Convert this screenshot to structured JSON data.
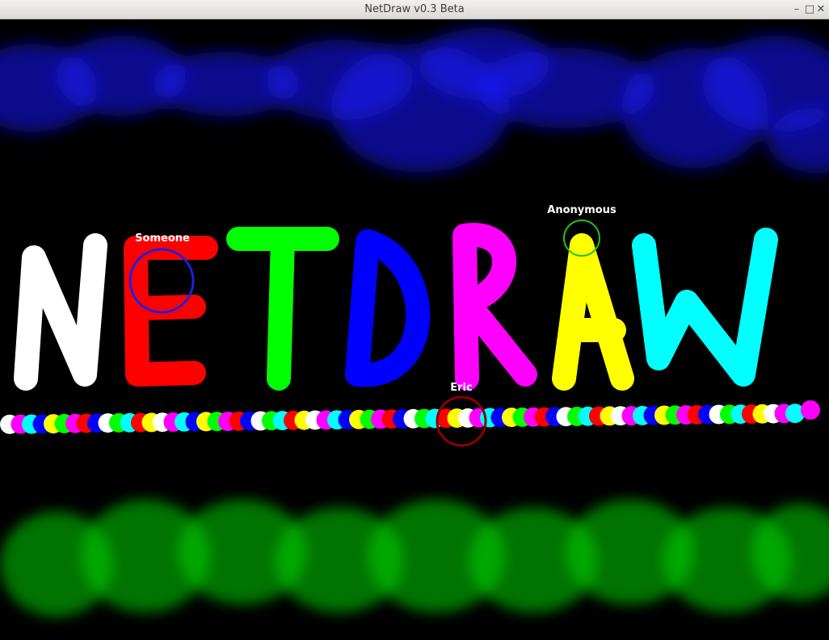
{
  "window": {
    "title": "NetDraw v0.3 Beta",
    "controls": {
      "minimize": "–",
      "maximize": "□",
      "close": "✕"
    }
  },
  "canvas": {
    "background": "#000000",
    "stroke_colors": [
      "#ffffff",
      "#ff0000",
      "#00ff00",
      "#0000ff",
      "#ff00ff",
      "#ffff00",
      "#00ffff"
    ]
  },
  "cursors": [
    {
      "name": "Someone",
      "color": "#2020e0"
    },
    {
      "name": "Anonymous",
      "color": "#20c020"
    },
    {
      "name": "Eric",
      "color": "#8b0000"
    }
  ]
}
